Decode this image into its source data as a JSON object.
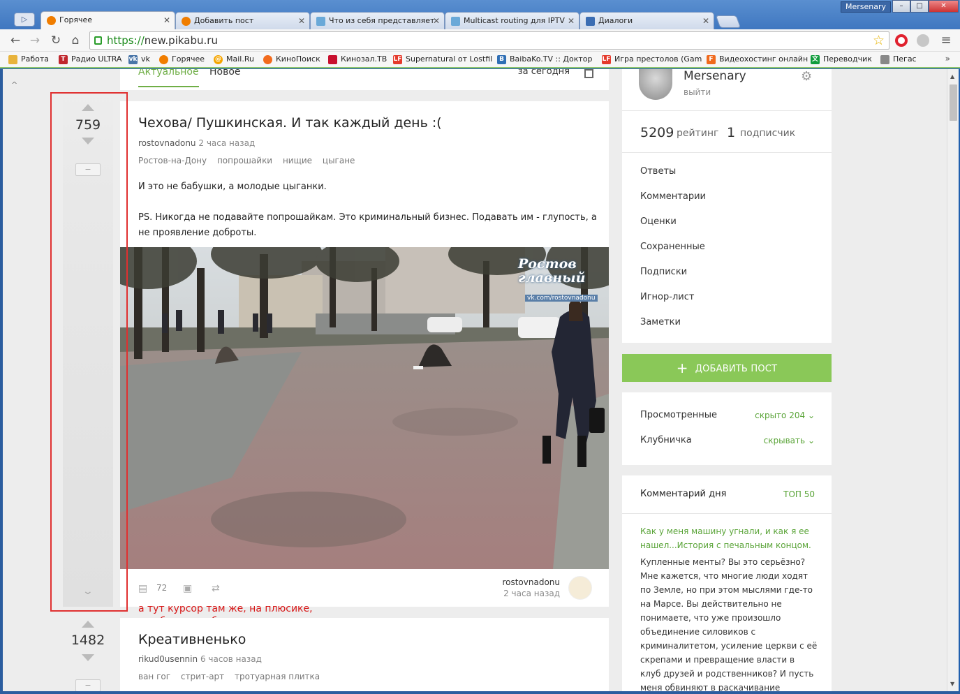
{
  "window": {
    "user_badge": "Mersenary",
    "minimize": "–",
    "maximize": "□",
    "close": "✕"
  },
  "tabs": [
    {
      "label": "Горячее",
      "active": true,
      "color": "#f07d00"
    },
    {
      "label": "Добавить пост",
      "active": false,
      "color": "#f07d00"
    },
    {
      "label": "Что из себя представляет",
      "active": false,
      "color": "#6aa9d8"
    },
    {
      "label": "Multicast routing для IPTV",
      "active": false,
      "color": "#6aa9d8"
    },
    {
      "label": "Диалоги",
      "active": false,
      "color": "#3b6db3"
    }
  ],
  "toolbar": {
    "back": "←",
    "forward": "→",
    "reload": "↻",
    "home": "⌂",
    "url_scheme": "https://",
    "url_host": "new.pikabu.ru",
    "star": "☆",
    "menu": "≡"
  },
  "bookmarks": [
    {
      "label": "Работа",
      "color": "#e8b33b"
    },
    {
      "label": "Радио ULTRA",
      "color": "#c0272d"
    },
    {
      "label": "vk",
      "color": "#4a76a8"
    },
    {
      "label": "Горячее",
      "color": "#f07d00"
    },
    {
      "label": "Mail.Ru",
      "color": "#f5a500"
    },
    {
      "label": "КиноПоиск",
      "color": "#f26b1d"
    },
    {
      "label": "Кинозал.ТВ",
      "color": "#c8102e"
    },
    {
      "label": "Supernatural от Lostfil",
      "color": "#e53a2c"
    },
    {
      "label": "BaibaKo.TV :: Доктор",
      "color": "#2f6fb5"
    },
    {
      "label": "Игра престолов (Gam",
      "color": "#e53a2c"
    },
    {
      "label": "Видеохостинг онлайн",
      "color": "#f06a1d"
    },
    {
      "label": "Переводчик",
      "color": "#109c3c"
    },
    {
      "label": "Пегас",
      "color": "#888888"
    }
  ],
  "bookmarks_more": "»",
  "feed": {
    "tab_actual": "Актуальное",
    "tab_new": "Новое",
    "period": "за сегодня",
    "back_to_top": "^"
  },
  "post1": {
    "votes": "759",
    "title": "Чехова/ Пушкинская. И так каждый день :(",
    "author": "rostovnadonu",
    "time": "2 часа назад",
    "tags": [
      "Ростов-на-Дону",
      "попрошайки",
      "нищие",
      "цыгане"
    ],
    "text_1": "И это не бабушки, а молодые цыганки.",
    "text_2": "PS. Никогда не подавайте попрошайкам. Это криминальный бизнес. Подавать им - глупость, а не проявление доброты.",
    "watermark": "Ростов главный",
    "watermark_url": "vk.com/rostovnadonu",
    "comments": "72"
  },
  "annotation": "а тут курсор там же, на плюсике,\nно область выбирается другая",
  "post2": {
    "votes": "1482",
    "title": "Креативненько",
    "author": "rikud0usennin",
    "time": "6 часов назад",
    "tags": [
      "ван гог",
      "стрит-арт",
      "тротуарная плитка"
    ]
  },
  "sidebar": {
    "username": "Mersenary",
    "logout": "выйти",
    "rating_value": "5209",
    "rating_label": "рейтинг",
    "subs_value": "1",
    "subs_label": "подписчик",
    "menu": [
      "Ответы",
      "Комментарии",
      "Оценки",
      "Сохраненные",
      "Подписки",
      "Игнор-лист",
      "Заметки"
    ],
    "add_post": "ДОБАВИТЬ ПОСТ",
    "filters": [
      {
        "label": "Просмотренные",
        "value": "скрыто 204"
      },
      {
        "label": "Клубничка",
        "value": "скрывать"
      }
    ],
    "comment_day": {
      "heading": "Комментарий дня",
      "top": "ТОП 50",
      "title": "Как у меня машину угнали, и как я ее нашел...История с печальным концом.",
      "body": "Купленные менты? Вы это серьёзно? Мне кажется, что многие люди ходят по Земле, но при этом мыслями где-то на Марсе. Вы действительно не понимаете, что уже произошло объединение силовиков с криминалитетом, усиление церкви с её скрепами и превращение власти в клуб друзей и родственников? И пусть меня обвиняют в раскачивание"
    }
  },
  "accent_color": "#8ac858"
}
